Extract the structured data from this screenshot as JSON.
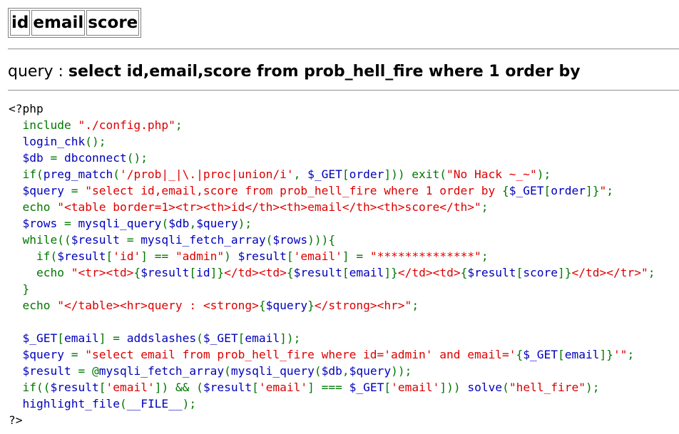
{
  "table": {
    "headers": [
      "id",
      "email",
      "score"
    ]
  },
  "query_prefix": "query : ",
  "query_text": "select id,email,score from prob_hell_fire where 1 order by",
  "source_lines": [
    [
      [
        "d",
        "<?php"
      ]
    ],
    [
      [
        "g",
        "  include "
      ],
      [
        "r",
        "\"./config.php\""
      ],
      [
        "g",
        ";"
      ]
    ],
    [
      [
        "g",
        "  "
      ],
      [
        "b",
        "login_chk"
      ],
      [
        "g",
        "();"
      ]
    ],
    [
      [
        "g",
        "  "
      ],
      [
        "b",
        "$db "
      ],
      [
        "g",
        "= "
      ],
      [
        "b",
        "dbconnect"
      ],
      [
        "g",
        "();"
      ]
    ],
    [
      [
        "g",
        "  if("
      ],
      [
        "b",
        "preg_match"
      ],
      [
        "g",
        "("
      ],
      [
        "r",
        "'/prob|_|\\.|proc|union/i'"
      ],
      [
        "g",
        ", "
      ],
      [
        "b",
        "$_GET"
      ],
      [
        "g",
        "["
      ],
      [
        "b",
        "order"
      ],
      [
        "g",
        "])) exit("
      ],
      [
        "r",
        "\"No Hack ~_~\""
      ],
      [
        "g",
        ");"
      ]
    ],
    [
      [
        "g",
        "  "
      ],
      [
        "b",
        "$query "
      ],
      [
        "g",
        "= "
      ],
      [
        "r",
        "\"select id,email,score from prob_hell_fire where 1 order by "
      ],
      [
        "g",
        "{"
      ],
      [
        "b",
        "$_GET"
      ],
      [
        "g",
        "["
      ],
      [
        "b",
        "order"
      ],
      [
        "g",
        "]}"
      ],
      [
        "r",
        "\""
      ],
      [
        "g",
        ";"
      ]
    ],
    [
      [
        "g",
        "  echo "
      ],
      [
        "r",
        "\"<table border=1><tr><th>id</th><th>email</th><th>score</th>\""
      ],
      [
        "g",
        ";"
      ]
    ],
    [
      [
        "g",
        "  "
      ],
      [
        "b",
        "$rows "
      ],
      [
        "g",
        "= "
      ],
      [
        "b",
        "mysqli_query"
      ],
      [
        "g",
        "("
      ],
      [
        "b",
        "$db"
      ],
      [
        "g",
        ","
      ],
      [
        "b",
        "$query"
      ],
      [
        "g",
        ");"
      ]
    ],
    [
      [
        "g",
        "  while(("
      ],
      [
        "b",
        "$result "
      ],
      [
        "g",
        "= "
      ],
      [
        "b",
        "mysqli_fetch_array"
      ],
      [
        "g",
        "("
      ],
      [
        "b",
        "$rows"
      ],
      [
        "g",
        "))){"
      ]
    ],
    [
      [
        "g",
        "    if("
      ],
      [
        "b",
        "$result"
      ],
      [
        "g",
        "["
      ],
      [
        "r",
        "'id'"
      ],
      [
        "g",
        "] == "
      ],
      [
        "r",
        "\"admin\""
      ],
      [
        "g",
        ") "
      ],
      [
        "b",
        "$result"
      ],
      [
        "g",
        "["
      ],
      [
        "r",
        "'email'"
      ],
      [
        "g",
        "] = "
      ],
      [
        "r",
        "\"**************\""
      ],
      [
        "g",
        ";"
      ]
    ],
    [
      [
        "g",
        "    echo "
      ],
      [
        "r",
        "\"<tr><td>"
      ],
      [
        "g",
        "{"
      ],
      [
        "b",
        "$result"
      ],
      [
        "g",
        "["
      ],
      [
        "b",
        "id"
      ],
      [
        "g",
        "]}"
      ],
      [
        "r",
        "</td><td>"
      ],
      [
        "g",
        "{"
      ],
      [
        "b",
        "$result"
      ],
      [
        "g",
        "["
      ],
      [
        "b",
        "email"
      ],
      [
        "g",
        "]}"
      ],
      [
        "r",
        "</td><td>"
      ],
      [
        "g",
        "{"
      ],
      [
        "b",
        "$result"
      ],
      [
        "g",
        "["
      ],
      [
        "b",
        "score"
      ],
      [
        "g",
        "]}"
      ],
      [
        "r",
        "</td></tr>\""
      ],
      [
        "g",
        ";"
      ]
    ],
    [
      [
        "g",
        "  }"
      ]
    ],
    [
      [
        "g",
        "  echo "
      ],
      [
        "r",
        "\"</table><hr>query : <strong>"
      ],
      [
        "g",
        "{"
      ],
      [
        "b",
        "$query"
      ],
      [
        "g",
        "}"
      ],
      [
        "r",
        "</strong><hr>\""
      ],
      [
        "g",
        ";"
      ]
    ],
    [
      [
        "g",
        ""
      ]
    ],
    [
      [
        "g",
        "  "
      ],
      [
        "b",
        "$_GET"
      ],
      [
        "g",
        "["
      ],
      [
        "b",
        "email"
      ],
      [
        "g",
        "] = "
      ],
      [
        "b",
        "addslashes"
      ],
      [
        "g",
        "("
      ],
      [
        "b",
        "$_GET"
      ],
      [
        "g",
        "["
      ],
      [
        "b",
        "email"
      ],
      [
        "g",
        "]);"
      ]
    ],
    [
      [
        "g",
        "  "
      ],
      [
        "b",
        "$query "
      ],
      [
        "g",
        "= "
      ],
      [
        "r",
        "\"select email from prob_hell_fire where id='admin' and email='"
      ],
      [
        "g",
        "{"
      ],
      [
        "b",
        "$_GET"
      ],
      [
        "g",
        "["
      ],
      [
        "b",
        "email"
      ],
      [
        "g",
        "]}"
      ],
      [
        "r",
        "'\""
      ],
      [
        "g",
        ";"
      ]
    ],
    [
      [
        "g",
        "  "
      ],
      [
        "b",
        "$result "
      ],
      [
        "g",
        "= @"
      ],
      [
        "b",
        "mysqli_fetch_array"
      ],
      [
        "g",
        "("
      ],
      [
        "b",
        "mysqli_query"
      ],
      [
        "g",
        "("
      ],
      [
        "b",
        "$db"
      ],
      [
        "g",
        ","
      ],
      [
        "b",
        "$query"
      ],
      [
        "g",
        "));"
      ]
    ],
    [
      [
        "g",
        "  if(("
      ],
      [
        "b",
        "$result"
      ],
      [
        "g",
        "["
      ],
      [
        "r",
        "'email'"
      ],
      [
        "g",
        "]) && ("
      ],
      [
        "b",
        "$result"
      ],
      [
        "g",
        "["
      ],
      [
        "r",
        "'email'"
      ],
      [
        "g",
        "] === "
      ],
      [
        "b",
        "$_GET"
      ],
      [
        "g",
        "["
      ],
      [
        "r",
        "'email'"
      ],
      [
        "g",
        "])) "
      ],
      [
        "b",
        "solve"
      ],
      [
        "g",
        "("
      ],
      [
        "r",
        "\"hell_fire\""
      ],
      [
        "g",
        ");"
      ]
    ],
    [
      [
        "g",
        "  "
      ],
      [
        "b",
        "highlight_file"
      ],
      [
        "g",
        "("
      ],
      [
        "b",
        "__FILE__"
      ],
      [
        "g",
        ");"
      ]
    ],
    [
      [
        "d",
        "?>"
      ]
    ]
  ]
}
